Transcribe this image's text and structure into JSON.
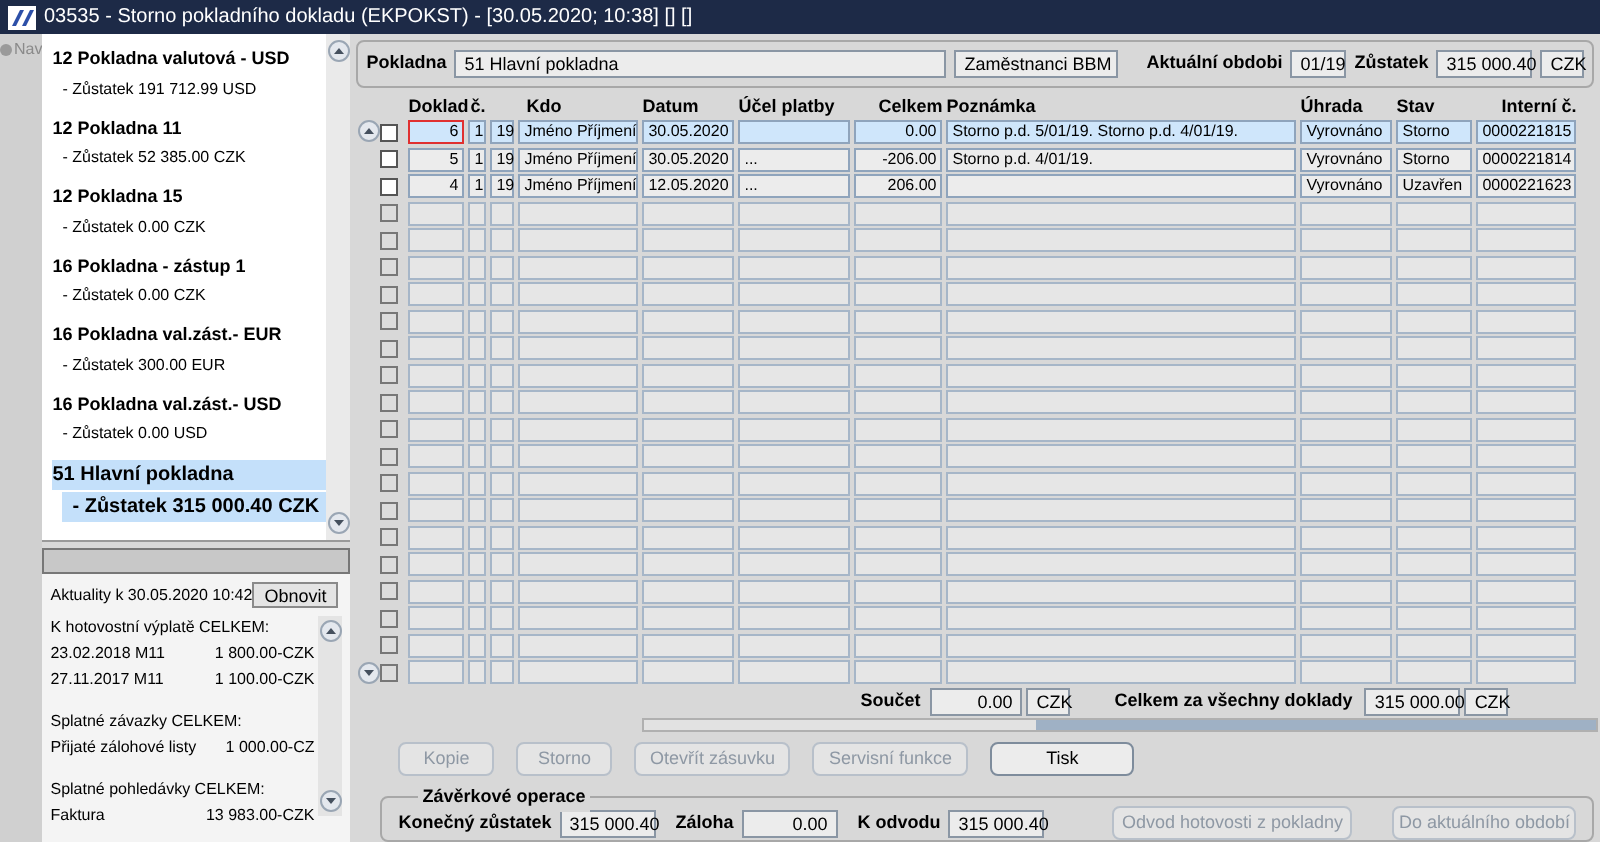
{
  "window": {
    "title": "03535 - Storno pokladního dokladu (EKPOKST) - [30.05.2020; 10:38] [] []"
  },
  "nav": {
    "label": "Nav"
  },
  "cash_desks": [
    {
      "name": "12 Pokladna valutová - USD",
      "balance": "- Zůstatek 191 712.99 USD",
      "selected": false
    },
    {
      "name": "12 Pokladna 11",
      "balance": "- Zůstatek 52 385.00 CZK",
      "selected": false
    },
    {
      "name": "12 Pokladna 15",
      "balance": "- Zůstatek 0.00 CZK",
      "selected": false
    },
    {
      "name": "16 Pokladna - zástup 1",
      "balance": "- Zůstatek 0.00 CZK",
      "selected": false
    },
    {
      "name": "16 Pokladna val.zást.- EUR",
      "balance": "- Zůstatek 300.00 EUR",
      "selected": false
    },
    {
      "name": "16 Pokladna val.zást.- USD",
      "balance": "- Zůstatek 0.00 USD",
      "selected": false
    },
    {
      "name": "51 Hlavní pokladna",
      "balance": "- Zůstatek 315 000.40 CZK",
      "selected": true
    }
  ],
  "news": {
    "label": "Aktuality k 30.05.2020 10:42",
    "refresh_button": "Obnovit",
    "sections": [
      {
        "heading": "K hotovostní výplatě CELKEM:",
        "lines": [
          [
            "23.02.2018 M11",
            "1 800.00-CZK"
          ],
          [
            "27.11.2017 M11",
            "1 100.00-CZK"
          ]
        ]
      },
      {
        "heading": "Splatné závazky CELKEM:",
        "lines": [
          [
            "Přijaté zálohové listy",
            "1 000.00-CZ"
          ]
        ]
      },
      {
        "heading": "Splatné pohledávky CELKEM:",
        "lines": [
          [
            "Faktura",
            "13 983.00-CZK"
          ]
        ]
      }
    ]
  },
  "header": {
    "cash_desk_label": "Pokladna",
    "cash_desk": "51 Hlavní pokladna",
    "group": "Zaměstnanci BBM",
    "period_label": "Aktuální obdobi",
    "period": "01/19",
    "balance_label": "Zůstatek",
    "balance": "315 000.40",
    "currency": "CZK"
  },
  "table": {
    "columns": [
      "Doklad",
      "č.",
      "",
      "Kdo",
      "Datum",
      "Účel platby",
      "Celkem",
      "Poznámka",
      "Úhrada",
      "Stav",
      "Interní č."
    ],
    "rows": [
      {
        "selected": true,
        "checked": false,
        "focused": true,
        "cells": [
          "6",
          "1",
          "19",
          "Jméno Příjmení",
          "30.05.2020",
          "",
          "0.00",
          "Storno p.d. 5/01/19. Storno p.d. 4/01/19.",
          "Vyrovnáno",
          "Storno",
          "0000221815"
        ]
      },
      {
        "selected": false,
        "checked": false,
        "focused": false,
        "cells": [
          "5",
          "1",
          "19",
          "Jméno Příjmení",
          "30.05.2020",
          "...",
          "-206.00",
          "Storno p.d. 4/01/19.",
          "Vyrovnáno",
          "Storno",
          "0000221814"
        ]
      },
      {
        "selected": false,
        "checked": false,
        "focused": false,
        "cells": [
          "4",
          "1",
          "19",
          "Jméno Příjmení",
          "12.05.2020",
          "...",
          "206.00",
          "",
          "Vyrovnáno",
          "Uzavřen",
          "0000221623"
        ]
      }
    ],
    "blank_rows": [
      {
        "checked": false
      },
      {
        "checked": false
      },
      {
        "checked": false
      },
      {
        "checked": false
      },
      {
        "checked": false
      },
      {
        "checked": false
      },
      {
        "checked": false
      },
      {
        "checked": false
      },
      {
        "checked": false
      },
      {
        "checked": false
      },
      {
        "checked": false
      },
      {
        "checked": false
      },
      {
        "checked": false
      },
      {
        "checked": false
      },
      {
        "checked": false
      },
      {
        "checked": false
      },
      {
        "checked": false
      },
      {
        "checked": false
      }
    ]
  },
  "totals": {
    "sum_label": "Součet",
    "sum": "0.00",
    "sum_currency": "CZK",
    "all_label": "Celkem za všechny doklady",
    "all": "315 000.00",
    "all_currency": "CZK"
  },
  "buttons": [
    {
      "label": "Kopie",
      "disabled": true
    },
    {
      "label": "Storno",
      "disabled": true
    },
    {
      "label": "Otevřít zásuvku",
      "disabled": true
    },
    {
      "label": "Servisní funkce",
      "disabled": true
    },
    {
      "label": "Tisk",
      "disabled": false
    }
  ],
  "closing": {
    "title": "Závěrkové operace",
    "fields": [
      {
        "label": "Konečný zůstatek",
        "value": "315 000.40"
      },
      {
        "label": "Záloha",
        "value": "0.00"
      },
      {
        "label": "K odvodu",
        "value": "315 000.40"
      }
    ],
    "buttons": [
      {
        "label": "Odvod hotovosti z pokladny",
        "disabled": true
      },
      {
        "label": "Do aktuálního období",
        "disabled": true
      }
    ]
  }
}
